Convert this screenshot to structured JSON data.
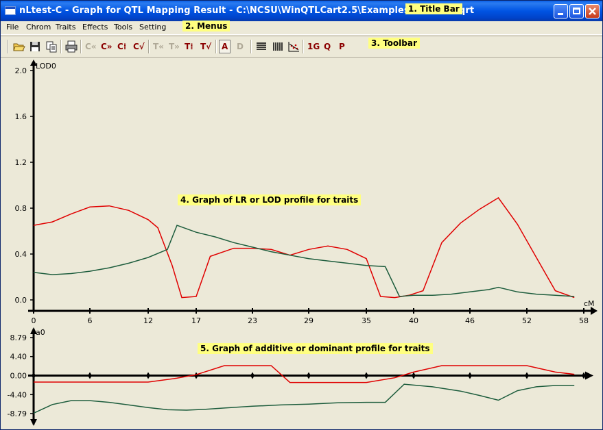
{
  "window": {
    "title": "nLtest-C - Graph for QTL Mapping Result - C:\\NCSU\\WinQTLCart2.5\\Examples\\nLtest-C.qrt"
  },
  "annotations": {
    "title_bar": "1. Title Bar",
    "menus": "2. Menus",
    "toolbar": "3. Toolbar",
    "lod_graph": "4. Graph of LR or LOD profile for traits",
    "effect_graph": "5. Graph of additive or dominant profile for traits"
  },
  "menus": [
    "File",
    "Chrom",
    "Traits",
    "Effects",
    "Tools",
    "Setting"
  ],
  "toolbar": {
    "icons": [
      "open-folder-icon",
      "save-icon",
      "copy-icon",
      "print-icon"
    ],
    "chrom_buttons": [
      "C«",
      "C»",
      "C⁞",
      "C√"
    ],
    "trait_buttons": [
      "T«",
      "T»",
      "T⁞",
      "T√"
    ],
    "effect_buttons": [
      "A",
      "D"
    ],
    "layout_buttons": [
      "rows-icon",
      "columns-icon",
      "scatter-icon"
    ],
    "misc_buttons": [
      "1G",
      "Q",
      "P"
    ]
  },
  "colors": {
    "trait1": "#e00000",
    "trait2": "#1c5c3c",
    "axis": "#000000",
    "background": "#ece9d8"
  },
  "chart_data": [
    {
      "type": "line",
      "ylabel": "LOD0",
      "xlabel": "cM",
      "ylim": [
        0,
        2.0
      ],
      "yticks": [
        "2.0",
        "1.6",
        "1.2",
        "0.8",
        "0.4",
        "0.0"
      ],
      "xticks": [
        "0",
        "6",
        "12",
        "17",
        "23",
        "29",
        "35",
        "40",
        "46",
        "52",
        "58"
      ],
      "series": [
        {
          "color": "#e00000",
          "points": [
            [
              0,
              0.65
            ],
            [
              2,
              0.68
            ],
            [
              4,
              0.75
            ],
            [
              6,
              0.81
            ],
            [
              8,
              0.82
            ],
            [
              10,
              0.78
            ],
            [
              12,
              0.7
            ],
            [
              13,
              0.63
            ],
            [
              14.5,
              0.3
            ],
            [
              15.5,
              0.02
            ],
            [
              17,
              0.03
            ],
            [
              18.5,
              0.38
            ],
            [
              21,
              0.45
            ],
            [
              23,
              0.45
            ],
            [
              25,
              0.44
            ],
            [
              27,
              0.39
            ],
            [
              29,
              0.44
            ],
            [
              31,
              0.47
            ],
            [
              33,
              0.44
            ],
            [
              35,
              0.36
            ],
            [
              36.5,
              0.03
            ],
            [
              38,
              0.02
            ],
            [
              39.5,
              0.04
            ],
            [
              41,
              0.08
            ],
            [
              43,
              0.5
            ],
            [
              45,
              0.67
            ],
            [
              47,
              0.79
            ],
            [
              49,
              0.89
            ],
            [
              51,
              0.66
            ],
            [
              53,
              0.37
            ],
            [
              55,
              0.08
            ],
            [
              57,
              0.02
            ]
          ]
        },
        {
          "color": "#1c5c3c",
          "points": [
            [
              0,
              0.24
            ],
            [
              2,
              0.22
            ],
            [
              4,
              0.23
            ],
            [
              6,
              0.25
            ],
            [
              8,
              0.28
            ],
            [
              10,
              0.32
            ],
            [
              12,
              0.37
            ],
            [
              14,
              0.44
            ],
            [
              15,
              0.65
            ],
            [
              17,
              0.59
            ],
            [
              19,
              0.55
            ],
            [
              21,
              0.5
            ],
            [
              23,
              0.46
            ],
            [
              25,
              0.42
            ],
            [
              27,
              0.39
            ],
            [
              29,
              0.36
            ],
            [
              31,
              0.34
            ],
            [
              33,
              0.32
            ],
            [
              35,
              0.3
            ],
            [
              37,
              0.29
            ],
            [
              38.5,
              0.03
            ],
            [
              40,
              0.04
            ],
            [
              42,
              0.04
            ],
            [
              44,
              0.05
            ],
            [
              46,
              0.07
            ],
            [
              48,
              0.09
            ],
            [
              49,
              0.11
            ],
            [
              51,
              0.07
            ],
            [
              53,
              0.05
            ],
            [
              55,
              0.04
            ],
            [
              57,
              0.03
            ]
          ]
        }
      ]
    },
    {
      "type": "line",
      "ylabel": "a0",
      "ylim": [
        -8.79,
        8.79
      ],
      "yticks": [
        "8.79",
        "4.40",
        "0.00",
        "-4.40",
        "-8.79"
      ],
      "series": [
        {
          "color": "#e00000",
          "points": [
            [
              0,
              -1.5
            ],
            [
              6,
              -1.5
            ],
            [
              12,
              -1.5
            ],
            [
              15,
              -0.6
            ],
            [
              17,
              0.2
            ],
            [
              20,
              2.3
            ],
            [
              23,
              2.3
            ],
            [
              25,
              2.3
            ],
            [
              27,
              -1.6
            ],
            [
              30,
              -1.6
            ],
            [
              35,
              -1.6
            ],
            [
              38,
              -0.5
            ],
            [
              40,
              0.8
            ],
            [
              43,
              2.3
            ],
            [
              46,
              2.3
            ],
            [
              49,
              2.3
            ],
            [
              52,
              2.3
            ],
            [
              55,
              0.8
            ],
            [
              57,
              0.3
            ]
          ]
        },
        {
          "color": "#1c5c3c",
          "points": [
            [
              0,
              -8.7
            ],
            [
              2,
              -6.7
            ],
            [
              4,
              -5.8
            ],
            [
              6,
              -5.8
            ],
            [
              8,
              -6.2
            ],
            [
              10,
              -6.8
            ],
            [
              12,
              -7.4
            ],
            [
              14,
              -7.9
            ],
            [
              16,
              -8.0
            ],
            [
              18,
              -7.8
            ],
            [
              20,
              -7.5
            ],
            [
              23,
              -7.1
            ],
            [
              26,
              -6.8
            ],
            [
              29,
              -6.6
            ],
            [
              32,
              -6.3
            ],
            [
              35,
              -6.2
            ],
            [
              37,
              -6.2
            ],
            [
              39,
              -2.0
            ],
            [
              42,
              -2.6
            ],
            [
              45,
              -3.6
            ],
            [
              47,
              -4.6
            ],
            [
              49,
              -5.7
            ],
            [
              51,
              -3.5
            ],
            [
              53,
              -2.6
            ],
            [
              55,
              -2.3
            ],
            [
              57,
              -2.3
            ]
          ]
        }
      ]
    }
  ]
}
